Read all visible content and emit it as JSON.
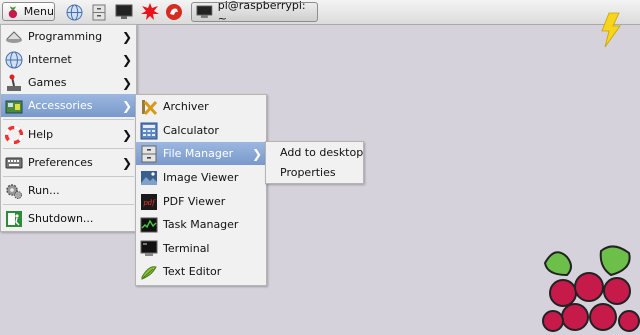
{
  "taskbar": {
    "menu_label": "Menu",
    "launchers": [
      "globe-icon",
      "file-cabinet-icon",
      "monitor-icon",
      "starburst-icon",
      "wolfram-icon"
    ],
    "task_label": "pi@raspberrypi: ~"
  },
  "main_menu": {
    "items": [
      {
        "label": "Programming",
        "icon": "programming-icon",
        "submenu": true
      },
      {
        "label": "Internet",
        "icon": "globe-icon",
        "submenu": true
      },
      {
        "label": "Games",
        "icon": "joystick-icon",
        "submenu": true
      },
      {
        "label": "Accessories",
        "icon": "accessories-icon",
        "submenu": true,
        "active": true
      },
      {
        "label": "Help",
        "icon": "lifebuoy-icon",
        "submenu": true
      },
      {
        "label": "Preferences",
        "icon": "preferences-icon",
        "submenu": true
      },
      {
        "label": "Run...",
        "icon": "gears-icon",
        "submenu": false
      },
      {
        "label": "Shutdown...",
        "icon": "exit-icon",
        "submenu": false
      }
    ]
  },
  "accessories_menu": {
    "items": [
      {
        "label": "Archiver",
        "icon": "archiver-icon"
      },
      {
        "label": "Calculator",
        "icon": "calculator-icon"
      },
      {
        "label": "File Manager",
        "icon": "file-manager-icon",
        "active": true,
        "submenu": true
      },
      {
        "label": "Image Viewer",
        "icon": "image-viewer-icon"
      },
      {
        "label": "PDF Viewer",
        "icon": "pdf-icon"
      },
      {
        "label": "Task Manager",
        "icon": "task-manager-icon"
      },
      {
        "label": "Terminal",
        "icon": "terminal-icon"
      },
      {
        "label": "Text Editor",
        "icon": "text-editor-icon"
      }
    ]
  },
  "context_menu": {
    "items": [
      {
        "label": "Add to desktop"
      },
      {
        "label": "Properties"
      }
    ]
  },
  "colors": {
    "desktop": "#d6d2db",
    "highlight": "#7a99cb",
    "bolt": "#f7d51d",
    "raspberry": "#c51a4a",
    "leaf": "#6cc04a"
  }
}
